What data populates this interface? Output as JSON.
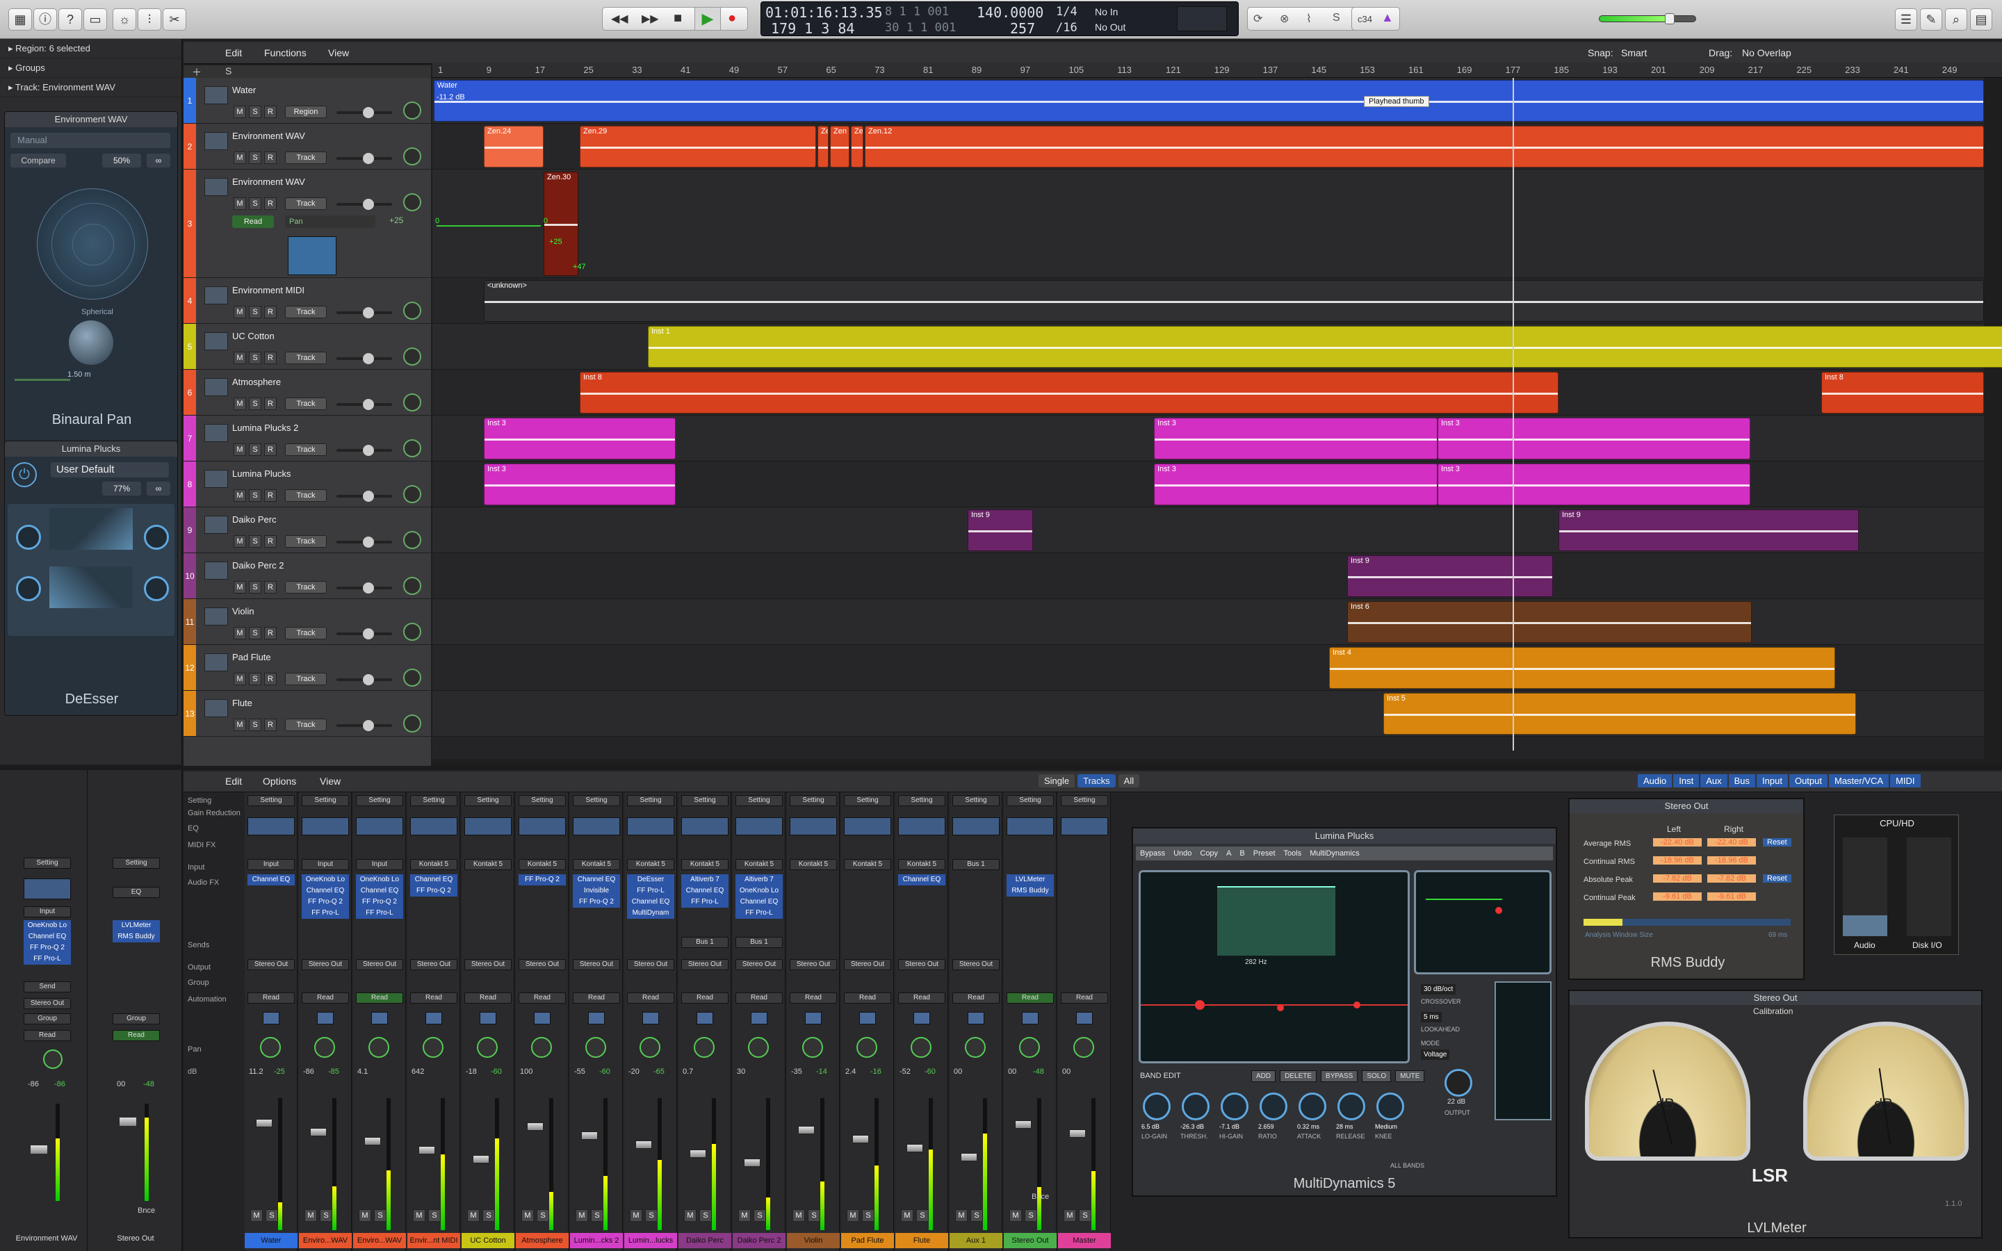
{
  "toolbar": {
    "transport": {
      "rewind": "◀◀",
      "forward": "▶▶",
      "stop": "■",
      "play": "▶",
      "record": "●"
    },
    "lcd": {
      "time": "01:01:16:13.35",
      "bars": "179  1  3   84",
      "bars_top": "8  1  1  001",
      "bars_sub": "30  1  1  001",
      "tempo": "140.0000",
      "tempo_sub": "257",
      "signature": "1/4",
      "division": "/16",
      "in": "No In",
      "out": "No Out"
    },
    "master_volume": 0.75,
    "cpu_label": "c34"
  },
  "inspector": {
    "region_label": "Region:",
    "region_value": "6 selected",
    "groups": "Groups",
    "track_label": "Track:",
    "track_value": "Environment WAV",
    "binaural_header": "Environment WAV",
    "binaural_mode": "Manual",
    "compare": "Compare",
    "binaural_percent": "50%",
    "binaural_mode2": "Spherical",
    "binaural_dist": "1.50 m",
    "binaural_title": "Binaural Pan",
    "deesser_header": "Lumina Plucks",
    "deesser_preset": "User Default",
    "deesser_percent": "77%",
    "deesser_title": "DeEsser",
    "strip_left": {
      "setting": "Setting",
      "input": "Input",
      "fx": [
        "OneKnob Lo",
        "Channel EQ",
        "FF Pro-Q 2",
        "FF Pro-L"
      ],
      "send": "Send",
      "output": "Stereo Out",
      "group": "Group",
      "automation": "Read",
      "pan_values": [
        "-86",
        "-86"
      ],
      "name": "Environment WAV"
    },
    "strip_right": {
      "setting": "Setting",
      "eq": "EQ",
      "fx": [
        "LVLMeter",
        "RMS Buddy"
      ],
      "group": "Group",
      "automation": "Read",
      "pan_values": [
        "00",
        "-48"
      ],
      "bnce": "Bnce",
      "name": "Stereo Out"
    }
  },
  "tracks_toolbar": {
    "edit": "Edit",
    "functions": "Functions",
    "view": "View",
    "snap_label": "Snap:",
    "snap_value": "Smart",
    "drag_label": "Drag:",
    "drag_value": "No Overlap"
  },
  "ruler": [
    "1",
    "9",
    "17",
    "25",
    "33",
    "41",
    "49",
    "57",
    "65",
    "73",
    "81",
    "89",
    "97",
    "105",
    "113",
    "121",
    "129",
    "137",
    "145",
    "153",
    "161",
    "169",
    "177",
    "185",
    "193",
    "201",
    "209",
    "217",
    "225",
    "233",
    "241",
    "249"
  ],
  "tracks": [
    {
      "num": "1",
      "name": "Water",
      "btn": "Region",
      "color": "#2f6fe0",
      "height": 66
    },
    {
      "num": "2",
      "name": "Environment WAV",
      "btn": "Track",
      "color": "#e8552e",
      "height": 66
    },
    {
      "num": "3",
      "name": "Environment WAV",
      "btn": "Track",
      "color": "#e8552e",
      "height": 156,
      "auto_mode": "Read",
      "auto_param": "Pan",
      "auto_value": "+25"
    },
    {
      "num": "4",
      "name": "Environment MIDI",
      "btn": "Track",
      "color": "#e8552e",
      "height": 66
    },
    {
      "num": "5",
      "name": "UC Cotton",
      "btn": "Track",
      "color": "#c9c515",
      "height": 66
    },
    {
      "num": "6",
      "name": "Atmosphere",
      "btn": "Track",
      "color": "#e8552e",
      "height": 66
    },
    {
      "num": "7",
      "name": "Lumina Plucks 2",
      "btn": "Track",
      "color": "#d43fc7",
      "height": 66
    },
    {
      "num": "8",
      "name": "Lumina Plucks",
      "btn": "Track",
      "color": "#d43fc7",
      "height": 66
    },
    {
      "num": "9",
      "name": "Daiko Perc",
      "btn": "Track",
      "color": "#8a3a86",
      "height": 66
    },
    {
      "num": "10",
      "name": "Daiko Perc 2",
      "btn": "Track",
      "color": "#8a3a86",
      "height": 66
    },
    {
      "num": "11",
      "name": "Violin",
      "btn": "Track",
      "color": "#9a5a2a",
      "height": 66
    },
    {
      "num": "12",
      "name": "Pad Flute",
      "btn": "Track",
      "color": "#e08a1a",
      "height": 66
    },
    {
      "num": "13",
      "name": "Flute",
      "btn": "Track",
      "color": "#e08a1a",
      "height": 66
    }
  ],
  "regions": {
    "water": "Water",
    "water_db": "-11.2 dB",
    "playhead_tip": "Playhead thumb",
    "zen24": "Zen.24",
    "zen29": "Zen.29",
    "zen_a": "Ze",
    "zen_b": "Zen",
    "zen_c": "Ze",
    "zen12": "Zen.12",
    "zen30": "Zen.30",
    "auto_0": "0",
    "auto_25": "+25",
    "auto_47": "+47",
    "auto_start": "0",
    "unknown": "<unknown>",
    "inst1": "Inst 1",
    "inst8a": "Inst 8",
    "inst8b": "Inst 8",
    "inst3a": "Inst 3",
    "inst3b": "Inst 3",
    "inst3c": "Inst 3",
    "inst3d": "Inst 3",
    "inst3e": "Inst 3",
    "inst3f": "Inst 3",
    "inst9a": "Inst 9",
    "inst9b": "Inst 9",
    "inst9c": "Inst 9",
    "inst6": "Inst 6",
    "inst4": "Inst 4",
    "inst5": "Inst 5"
  },
  "mixer_toolbar": {
    "edit": "Edit",
    "options": "Options",
    "view": "View",
    "modes": [
      "Single",
      "Tracks",
      "All"
    ],
    "filters": [
      "Audio",
      "Inst",
      "Aux",
      "Bus",
      "Input",
      "Output",
      "Master/VCA",
      "MIDI"
    ]
  },
  "row_labels": [
    "Setting",
    "Gain Reduction",
    "EQ",
    "MIDI FX",
    "Input",
    "Audio FX",
    "Sends",
    "Output",
    "Group",
    "Automation",
    "Pan",
    "dB"
  ],
  "strips": [
    {
      "name": "Water",
      "color": "#2f6fe0",
      "input": "Input",
      "fx": [
        "Channel EQ"
      ],
      "output": "Stereo Out",
      "auto": "Read",
      "db": [
        "11.2",
        "-25"
      ]
    },
    {
      "name": "Enviro...WAV",
      "color": "#e8552e",
      "input": "Input",
      "fx": [
        "OneKnob Lo",
        "Channel EQ",
        "FF Pro-Q 2",
        "FF Pro-L"
      ],
      "output": "Stereo Out",
      "auto": "Read",
      "db": [
        "-86",
        "-85"
      ]
    },
    {
      "name": "Enviro...WAV",
      "color": "#e8552e",
      "input": "Input",
      "fx": [
        "OneKnob Lo",
        "Channel EQ",
        "FF Pro-Q 2",
        "FF Pro-L"
      ],
      "output": "Stereo Out",
      "auto": "Read",
      "db": [
        "4.1",
        ""
      ]
    },
    {
      "name": "Envir...nt MIDI",
      "color": "#e8552e",
      "input": "Kontakt 5",
      "fx": [
        "Channel EQ",
        "FF Pro-Q 2"
      ],
      "output": "Stereo Out",
      "auto": "Read",
      "db": [
        "642",
        ""
      ]
    },
    {
      "name": "UC Cotton",
      "color": "#c9c515",
      "input": "Kontakt 5",
      "fx": [],
      "output": "Stereo Out",
      "auto": "Read",
      "db": [
        "-18",
        "-60"
      ]
    },
    {
      "name": "Atmosphere",
      "color": "#e8552e",
      "input": "Kontakt 5",
      "fx": [
        "FF Pro-Q 2"
      ],
      "output": "Stereo Out",
      "auto": "Read",
      "db": [
        "100",
        ""
      ]
    },
    {
      "name": "Lumin...cks 2",
      "color": "#d43fc7",
      "input": "Kontakt 5",
      "fx": [
        "Channel EQ",
        "Invisible",
        "FF Pro-Q 2"
      ],
      "output": "Stereo Out",
      "auto": "Read",
      "db": [
        "-55",
        "-60"
      ]
    },
    {
      "name": "Lumin...lucks",
      "color": "#d43fc7",
      "input": "Kontakt 5",
      "fx": [
        "DeEsser",
        "FF Pro-L",
        "Channel EQ",
        "MultiDynam"
      ],
      "output": "Stereo Out",
      "auto": "Read",
      "db": [
        "-20",
        "-65"
      ]
    },
    {
      "name": "Daiko Perc",
      "color": "#8a3a86",
      "input": "Kontakt 5",
      "fx": [
        "Altiverb 7",
        "Channel EQ",
        "FF Pro-L"
      ],
      "send": "Bus 1",
      "output": "Stereo Out",
      "auto": "Read",
      "db": [
        "0.7",
        ""
      ]
    },
    {
      "name": "Daiko Perc 2",
      "color": "#8a3a86",
      "input": "Kontakt 5",
      "fx": [
        "Altiverb 7",
        "OneKnob Lo",
        "Channel EQ",
        "FF Pro-L"
      ],
      "send": "Bus 1",
      "output": "Stereo Out",
      "auto": "Read",
      "db": [
        "30",
        ""
      ]
    },
    {
      "name": "Violin",
      "color": "#9a5a2a",
      "input": "Kontakt 5",
      "fx": [],
      "output": "Stereo Out",
      "auto": "Read",
      "db": [
        "-35",
        "-14"
      ]
    },
    {
      "name": "Pad Flute",
      "color": "#e08a1a",
      "input": "Kontakt 5",
      "fx": [],
      "output": "Stereo Out",
      "auto": "Read",
      "db": [
        "2.4",
        "-16"
      ]
    },
    {
      "name": "Flute",
      "color": "#e08a1a",
      "input": "Kontakt 5",
      "fx": [
        "Channel EQ"
      ],
      "output": "Stereo Out",
      "auto": "Read",
      "db": [
        "-52",
        "-60"
      ]
    },
    {
      "name": "Aux 1",
      "color": "#a8a020",
      "input": "Bus 1",
      "fx": [],
      "output": "Stereo Out",
      "auto": "Read",
      "db": [
        "00",
        ""
      ]
    },
    {
      "name": "Stereo Out",
      "color": "#4bb04b",
      "input": "",
      "fx": [
        "LVLMeter",
        "RMS Buddy"
      ],
      "output": "",
      "auto": "Read",
      "db": [
        "00",
        "-48"
      ],
      "bnce": "Bnce"
    },
    {
      "name": "Master",
      "color": "#e0409a",
      "input": "",
      "fx": [],
      "output": "",
      "auto": "Read",
      "db": [
        "00",
        ""
      ]
    }
  ],
  "multidynamics": {
    "title": "Lumina Plucks",
    "bar": [
      "Bypass",
      "Undo",
      "Copy",
      "A",
      "B",
      "Preset",
      "Tools",
      "MultiDynamics"
    ],
    "band_edit": "BAND EDIT",
    "band_btns": [
      "ADD",
      "DELETE",
      "BYPASS",
      "SOLO",
      "MUTE"
    ],
    "knob_labels": [
      "LO-GAIN",
      "THRESH.",
      "HI-GAIN",
      "RATIO",
      "ATTACK",
      "RELEASE",
      "KNEE"
    ],
    "knob_values": [
      "6.5 dB",
      "-26.3 dB",
      "-7.1 dB",
      "2.659",
      "0.32 ms",
      "28 ms",
      "Medium"
    ],
    "crossover": "CROSSOVER",
    "xover_val": "30 dB/oct",
    "lookahead": "LOOKAHEAD",
    "la_val": "5 ms",
    "mode": "MODE",
    "mode_val": "Voltage",
    "output": "OUTPUT",
    "out_val": "22 dB",
    "all_bands": "ALL BANDS",
    "freq": "282 Hz",
    "footer": "MultiDynamics 5"
  },
  "rms": {
    "title": "Stereo Out",
    "left": "Left",
    "right": "Right",
    "rows": [
      {
        "label": "Average RMS",
        "l": "-22.40 dB",
        "r": "-22.40 dB",
        "reset": "Reset"
      },
      {
        "label": "Continual RMS",
        "l": "-18.96 dB",
        "r": "-18.96 dB",
        "reset": ""
      },
      {
        "label": "Absolute Peak",
        "l": "-7.82 dB",
        "r": "-7.82 dB",
        "reset": "Reset"
      },
      {
        "label": "Continual Peak",
        "l": "-9.61 dB",
        "r": "-9.61 dB",
        "reset": ""
      }
    ],
    "window": "Analysis Window Size",
    "window_val": "69 ms",
    "footer": "RMS Buddy"
  },
  "cpu": {
    "title": "CPU/HD",
    "audio": "Audio",
    "disk": "Disk I/O"
  },
  "lvl": {
    "title": "Stereo Out",
    "calibration": "Calibration",
    "db": "dB",
    "footer": "LVLMeter",
    "version": "1.1.0",
    "logo": "LSR"
  }
}
